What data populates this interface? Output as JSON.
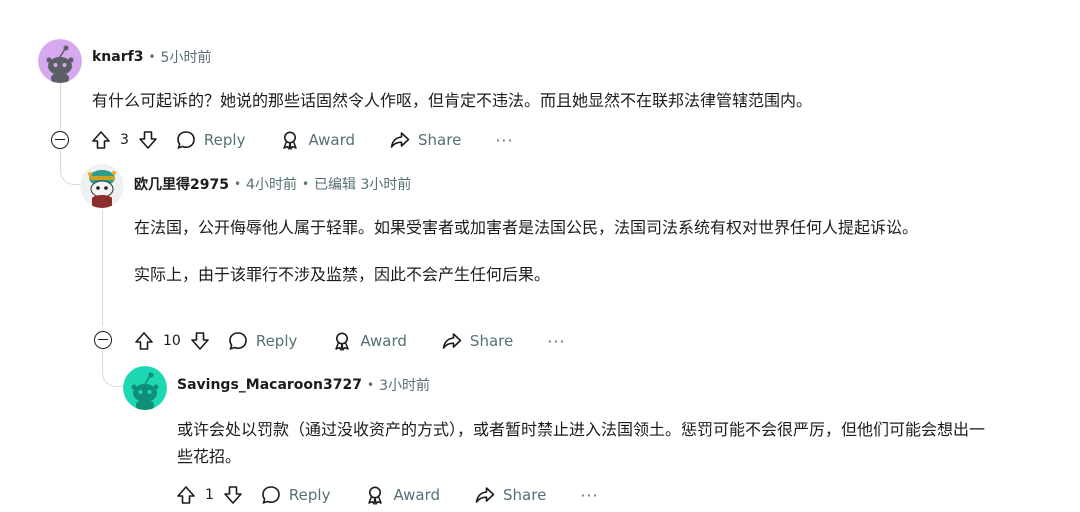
{
  "comments": [
    {
      "username": "knarf3",
      "meta": "5小时前",
      "body": [
        "有什么可起诉的？她说的那些话固然令人作呕，但肯定不违法。而且她显然不在联邦法律管辖范围内。"
      ],
      "votes": "3",
      "avatar_color": "#d6a8ee"
    },
    {
      "username": "欧几里得2975",
      "meta": "4小时前",
      "edited": "已编辑 3小时前",
      "body": [
        "在法国，公开侮辱他人属于轻罪。如果受害者或加害者是法国公民，法国司法系统有权对世界任何人提起诉讼。",
        "实际上，由于该罪行不涉及监禁，因此不会产生任何后果。"
      ],
      "votes": "10",
      "avatar_color": "#2f9e8f"
    },
    {
      "username": "Savings_Macaroon3727",
      "meta": "3小时前",
      "body": [
        "或许会处以罚款（通过没收资产的方式），或者暂时禁止进入法国领土。惩罚可能不会很严厉，但他们可能会想出一些花招。"
      ],
      "votes": "1",
      "avatar_color": "#1ed8b4"
    }
  ],
  "actions": {
    "reply": "Reply",
    "award": "Award",
    "share": "Share",
    "more": "···"
  },
  "icons": [
    "upvote-icon",
    "downvote-icon",
    "reply-icon",
    "award-icon",
    "share-icon",
    "collapse-icon"
  ]
}
